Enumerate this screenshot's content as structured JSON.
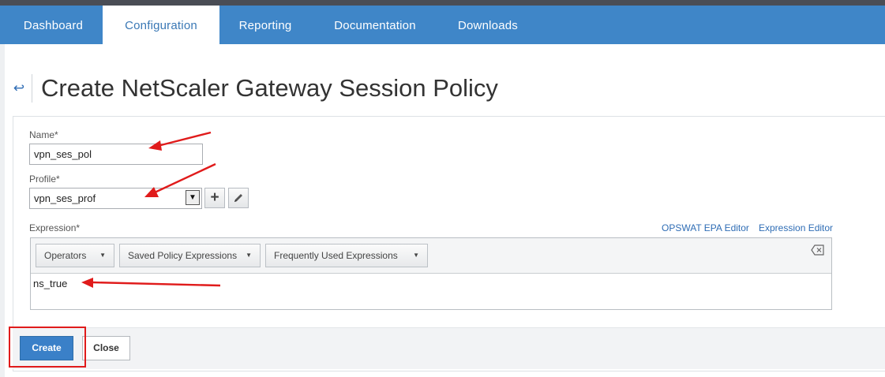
{
  "nav": {
    "tabs": [
      {
        "label": "Dashboard"
      },
      {
        "label": "Configuration"
      },
      {
        "label": "Reporting"
      },
      {
        "label": "Documentation"
      },
      {
        "label": "Downloads"
      }
    ],
    "active": "Configuration"
  },
  "page": {
    "back_icon": "back-arrow-icon",
    "title": "Create NetScaler Gateway Session Policy"
  },
  "form": {
    "name_label": "Name*",
    "name_value": "vpn_ses_pol",
    "profile_label": "Profile*",
    "profile_value": "vpn_ses_prof",
    "add_icon": "+",
    "edit_icon": "pencil-icon",
    "expression_label": "Expression*",
    "opswat_link": "OPSWAT EPA Editor",
    "expression_editor_link": "Expression Editor",
    "operators_label": "Operators",
    "saved_policy_label": "Saved Policy Expressions",
    "frequently_used_label": "Frequently Used Expressions",
    "clear_icon": "clear-backspace-icon",
    "expression_value": "ns_true"
  },
  "footer": {
    "create_label": "Create",
    "close_label": "Close"
  },
  "annotations": {
    "arrow_color": "#e01b1b",
    "highlight_color": "#e01b1b"
  },
  "colors": {
    "nav_bg": "#3f86c8",
    "accent": "#3a80c8",
    "link": "#2f6db5"
  }
}
